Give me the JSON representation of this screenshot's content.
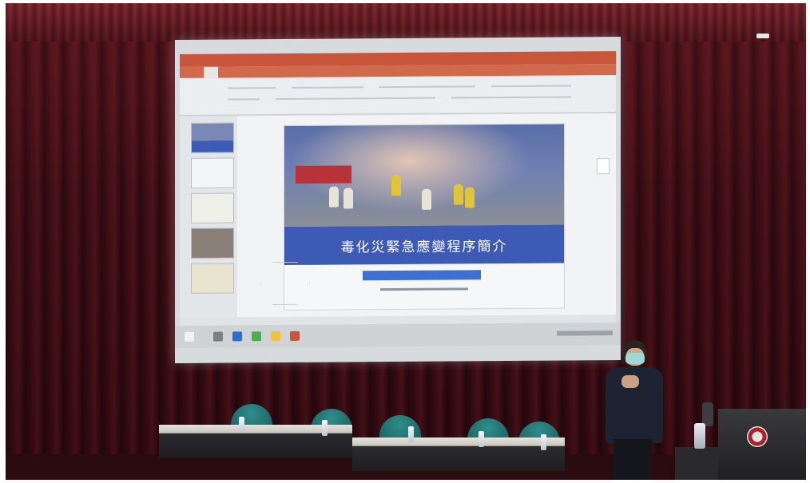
{
  "scene": {
    "description_label": "",
    "slide_title": "毒化災緊急應變程序簡介",
    "colors": {
      "curtain": "#3e0f16",
      "slide_banner": "#3d5ab4",
      "ppt_accent": "#c9563a",
      "chair": "#1f7472"
    }
  }
}
